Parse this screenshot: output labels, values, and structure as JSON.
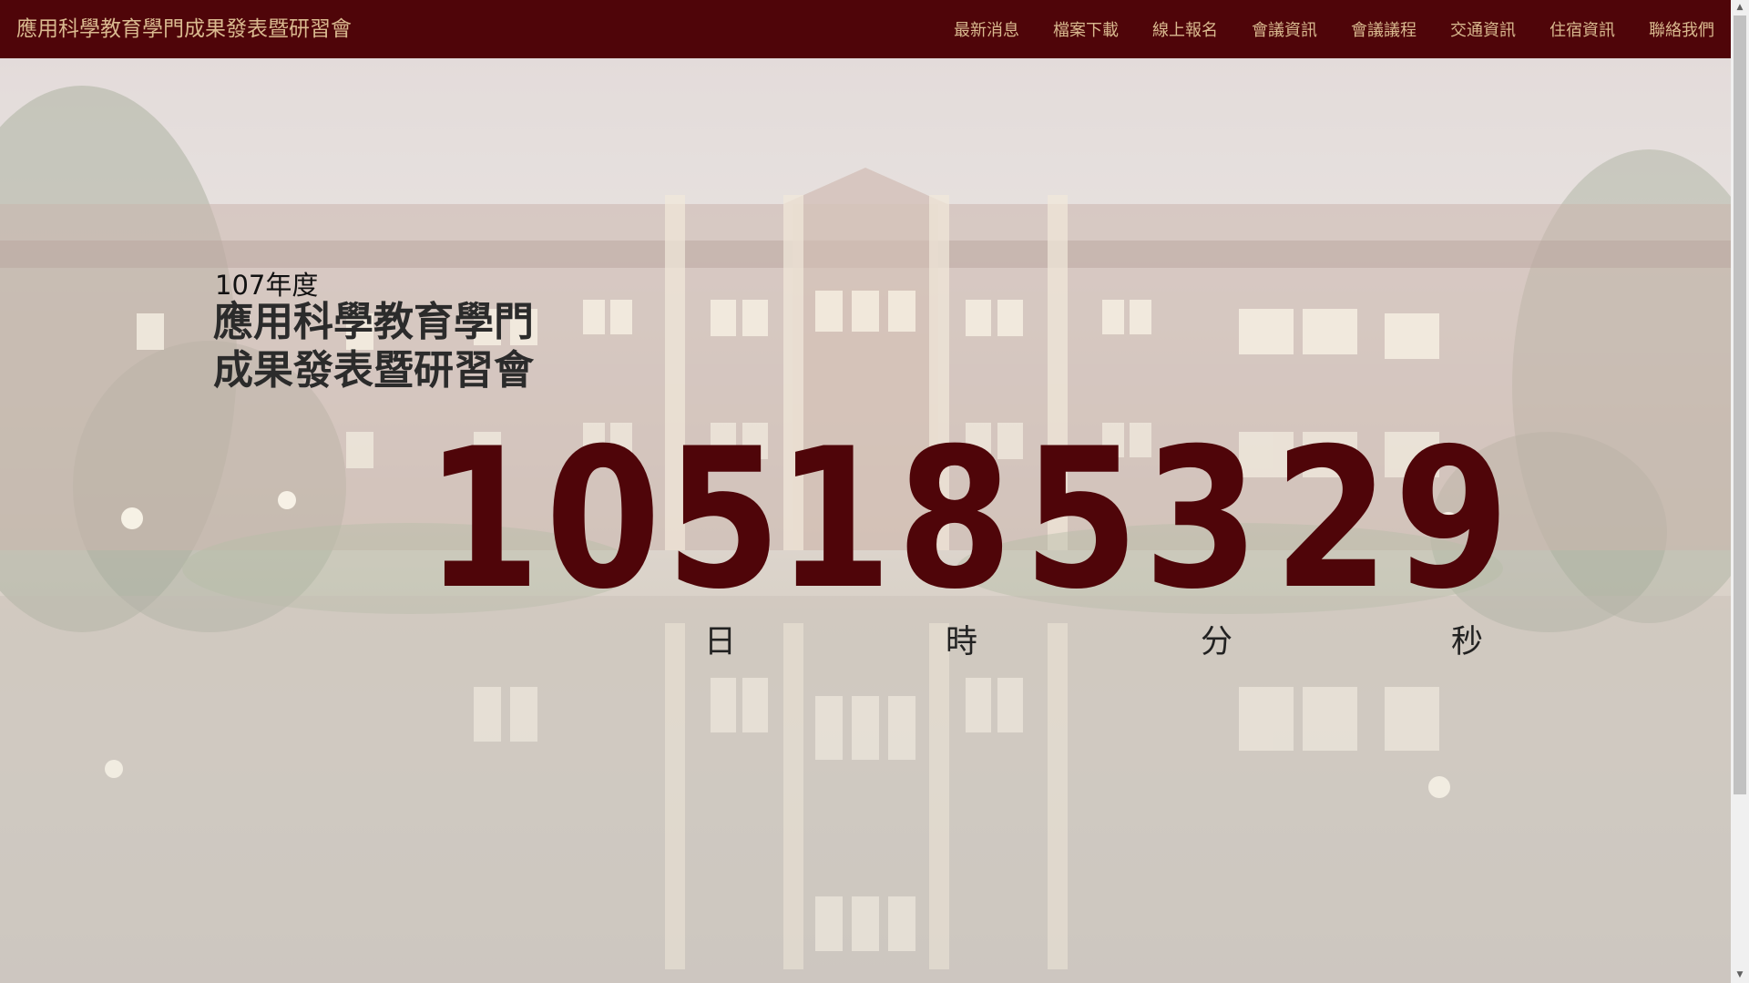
{
  "navbar": {
    "brand": "應用科學教育學門成果發表暨研習會",
    "links": [
      "最新消息",
      "檔案下載",
      "線上報名",
      "會議資訊",
      "會議議程",
      "交通資訊",
      "住宿資訊",
      "聯絡我們"
    ]
  },
  "hero": {
    "year": "107年度",
    "title_lines": [
      "應用科學教育學門",
      "成果發表暨研習會"
    ]
  },
  "countdown": {
    "days": "105",
    "hours": "18",
    "minutes": "53",
    "seconds": "29",
    "labels": {
      "days": "日",
      "hours": "時",
      "minutes": "分",
      "seconds": "秒"
    }
  },
  "colors": {
    "navbar_bg": "#4f0509",
    "navbar_text": "#d9b98f",
    "countdown_digits": "#4f0509"
  },
  "icons": {
    "scroll_up": "▲",
    "scroll_down": "▼"
  }
}
